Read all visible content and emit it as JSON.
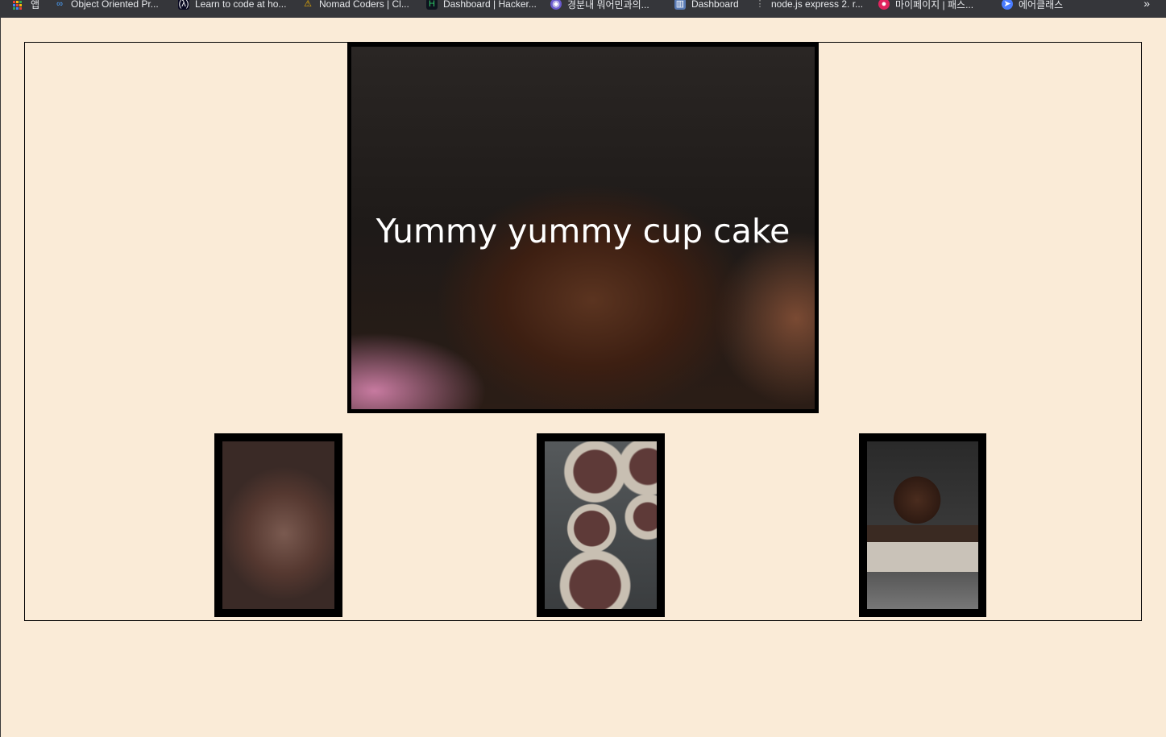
{
  "bookmarks_bar": {
    "apps_label": "앱",
    "items": [
      {
        "label": "Object Oriented Pr...",
        "icon": "infinity-icon"
      },
      {
        "label": "Learn to code at ho...",
        "icon": "freecodecamp-icon"
      },
      {
        "label": "Nomad Coders | Cl...",
        "icon": "warning-triangle-icon"
      },
      {
        "label": "Dashboard | Hacker...",
        "icon": "hackerrank-icon"
      },
      {
        "label": "경분내 뭐어민과의...",
        "icon": "bookmark-icon"
      },
      {
        "label": "Dashboard",
        "icon": "dashboard-icon"
      },
      {
        "label": "node.js express 2. r...",
        "icon": "dots-icon"
      },
      {
        "label": "마이페이지 | 패스...",
        "icon": "red-logo-icon"
      },
      {
        "label": "에어클래스",
        "icon": "paper-plane-icon"
      }
    ],
    "more_label": "»"
  },
  "page": {
    "hero_title": "Yummy yummy cup cake",
    "hero_image": "chocolate-cupcake-photo",
    "thumbnails": [
      "chocolate-batter-bowl-photo",
      "cupcake-tin-photo",
      "chocolate-cupcake-photo"
    ]
  },
  "colors": {
    "page_background": "#faebd7",
    "frame_border": "#000000",
    "hero_text": "#ffffff"
  }
}
